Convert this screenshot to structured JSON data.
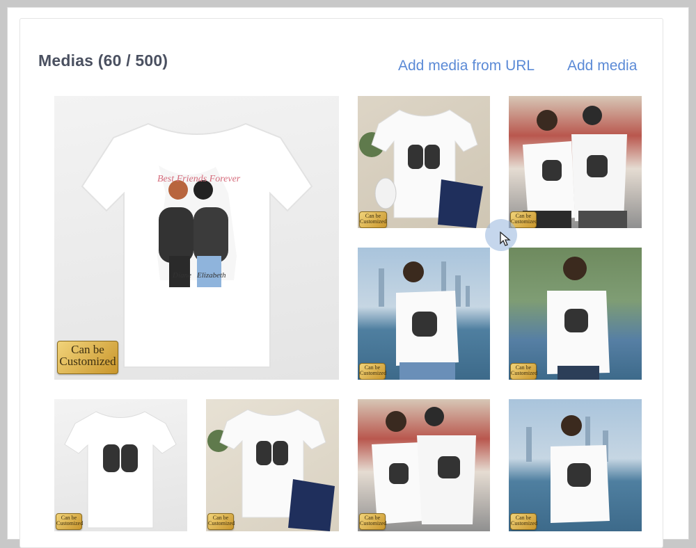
{
  "section": {
    "title": "Medias (60 / 500)",
    "add_url_label": "Add media from URL",
    "add_media_label": "Add media"
  },
  "tiles": [
    {
      "name": "media-tile-1",
      "badge_line1": "Can be",
      "badge_line2": "Customized",
      "print_title": "Best Friends Forever",
      "name_left": "Diane",
      "name_right": "Elizabeth"
    },
    {
      "name": "media-tile-2",
      "badge_line1": "Can be",
      "badge_line2": "Customized"
    },
    {
      "name": "media-tile-3",
      "badge_line1": "Can be",
      "badge_line2": "Customized"
    },
    {
      "name": "media-tile-4",
      "badge_line1": "Can be",
      "badge_line2": "Customized"
    },
    {
      "name": "media-tile-5",
      "badge_line1": "Can be",
      "badge_line2": "Customized"
    },
    {
      "name": "media-tile-6",
      "badge_line1": "Can be",
      "badge_line2": "Customized"
    },
    {
      "name": "media-tile-7",
      "badge_line1": "Can be",
      "badge_line2": "Customized"
    },
    {
      "name": "media-tile-8",
      "badge_line1": "Can be",
      "badge_line2": "Customized"
    },
    {
      "name": "media-tile-9",
      "badge_line1": "Can be",
      "badge_line2": "Customized"
    }
  ],
  "icons": {
    "cursor": "mouse-pointer-icon"
  }
}
